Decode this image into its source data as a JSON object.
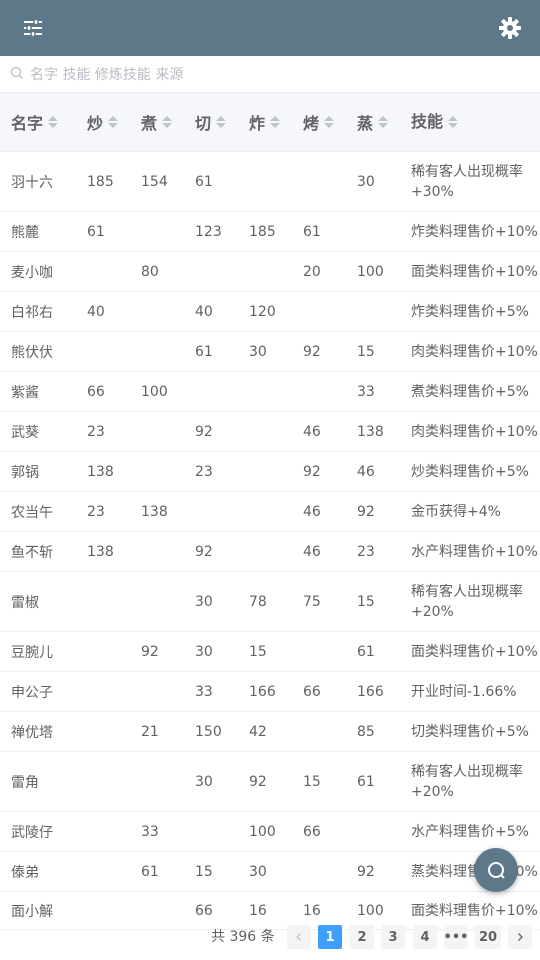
{
  "search": {
    "placeholder": "名字 技能 修炼技能 来源"
  },
  "table": {
    "headers": [
      "名字",
      "炒",
      "煮",
      "切",
      "炸",
      "烤",
      "蒸",
      "技能"
    ],
    "rows": [
      {
        "name": "羽十六",
        "chao": "185",
        "zhu": "154",
        "qie": "61",
        "zha": "",
        "kao": "",
        "zheng": "30",
        "skill": "稀有客人出现概率+30%"
      },
      {
        "name": "熊麓",
        "chao": "61",
        "zhu": "",
        "qie": "123",
        "zha": "185",
        "kao": "61",
        "zheng": "",
        "skill": "炸类料理售价+10%"
      },
      {
        "name": "麦小咖",
        "chao": "",
        "zhu": "80",
        "qie": "",
        "zha": "",
        "kao": "20",
        "zheng": "100",
        "skill": "面类料理售价+10%"
      },
      {
        "name": "白祁右",
        "chao": "40",
        "zhu": "",
        "qie": "40",
        "zha": "120",
        "kao": "",
        "zheng": "",
        "skill": "炸类料理售价+5%"
      },
      {
        "name": "熊伏伏",
        "chao": "",
        "zhu": "",
        "qie": "61",
        "zha": "30",
        "kao": "92",
        "zheng": "15",
        "skill": "肉类料理售价+10%"
      },
      {
        "name": "紫酱",
        "chao": "66",
        "zhu": "100",
        "qie": "",
        "zha": "",
        "kao": "",
        "zheng": "33",
        "skill": "煮类料理售价+5%"
      },
      {
        "name": "武葵",
        "chao": "23",
        "zhu": "",
        "qie": "92",
        "zha": "",
        "kao": "46",
        "zheng": "138",
        "skill": "肉类料理售价+10%"
      },
      {
        "name": "郭锅",
        "chao": "138",
        "zhu": "",
        "qie": "23",
        "zha": "",
        "kao": "92",
        "zheng": "46",
        "skill": "炒类料理售价+5%"
      },
      {
        "name": "农当午",
        "chao": "23",
        "zhu": "138",
        "qie": "",
        "zha": "",
        "kao": "46",
        "zheng": "92",
        "skill": "金币获得+4%"
      },
      {
        "name": "鱼不斩",
        "chao": "138",
        "zhu": "",
        "qie": "92",
        "zha": "",
        "kao": "46",
        "zheng": "23",
        "skill": "水产料理售价+10%"
      },
      {
        "name": "雷椒",
        "chao": "",
        "zhu": "",
        "qie": "30",
        "zha": "78",
        "kao": "75",
        "zheng": "15",
        "skill": "稀有客人出现概率+20%"
      },
      {
        "name": "豆腕儿",
        "chao": "",
        "zhu": "92",
        "qie": "30",
        "zha": "15",
        "kao": "",
        "zheng": "61",
        "skill": "面类料理售价+10%"
      },
      {
        "name": "申公子",
        "chao": "",
        "zhu": "",
        "qie": "33",
        "zha": "166",
        "kao": "66",
        "zheng": "166",
        "skill": "开业时间-1.66%"
      },
      {
        "name": "禅优塔",
        "chao": "",
        "zhu": "21",
        "qie": "150",
        "zha": "42",
        "kao": "",
        "zheng": "85",
        "skill": "切类料理售价+5%"
      },
      {
        "name": "雷角",
        "chao": "",
        "zhu": "",
        "qie": "30",
        "zha": "92",
        "kao": "15",
        "zheng": "61",
        "skill": "稀有客人出现概率+20%"
      },
      {
        "name": "武陵仔",
        "chao": "",
        "zhu": "33",
        "qie": "",
        "zha": "100",
        "kao": "66",
        "zheng": "",
        "skill": "水产料理售价+5%"
      },
      {
        "name": "傣弟",
        "chao": "",
        "zhu": "61",
        "qie": "15",
        "zha": "30",
        "kao": "",
        "zheng": "92",
        "skill": "蒸类料理售价+10%"
      },
      {
        "name": "面小解",
        "chao": "",
        "zhu": "",
        "qie": "66",
        "zha": "16",
        "kao": "16",
        "zheng": "100",
        "skill": "面类料理售价+10%"
      }
    ]
  },
  "pagination": {
    "total": "共 396 条",
    "pages": [
      "1",
      "2",
      "3",
      "4",
      "•••",
      "20"
    ],
    "active": "1"
  },
  "colors": {
    "topbar": "#5d7888",
    "active": "#409eff"
  },
  "icons": {
    "menu": "sliders-icon",
    "settings": "gear-icon",
    "search": "search-icon",
    "fab": "search-fab-icon"
  }
}
